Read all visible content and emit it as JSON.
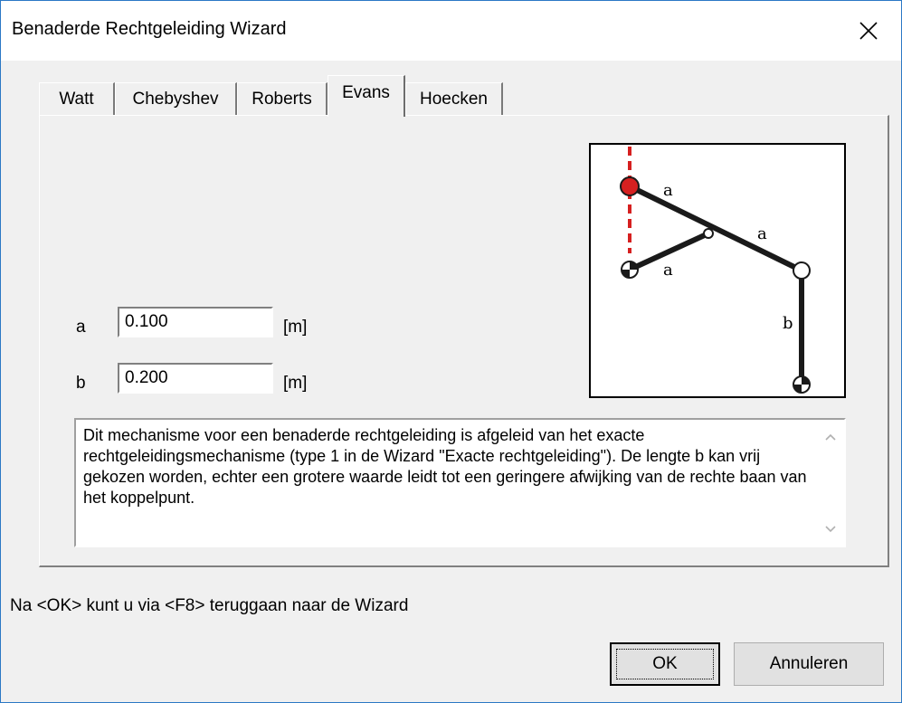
{
  "window": {
    "title": "Benaderde Rechtgeleiding Wizard"
  },
  "tabs": [
    {
      "label": "Watt",
      "active": false
    },
    {
      "label": "Chebyshev",
      "active": false
    },
    {
      "label": "Roberts",
      "active": false
    },
    {
      "label": "Evans",
      "active": true
    },
    {
      "label": "Hoecken",
      "active": false
    }
  ],
  "fields": {
    "a": {
      "label": "a",
      "value": "0.100",
      "unit": "[m]"
    },
    "b": {
      "label": "b",
      "value": "0.200",
      "unit": "[m]"
    }
  },
  "diagram": {
    "labels": {
      "a1": "a",
      "a2": "a",
      "a3": "a",
      "b": "b"
    },
    "colors": {
      "link": "#1a1a1a",
      "path": "#d62020",
      "coupler_point": "#d62020"
    }
  },
  "description": "Dit mechanisme voor een benaderde rechtgeleiding is afgeleid van het exacte rechtgeleidingsmechanisme (type 1 in de Wizard \"Exacte rechtgeleiding\"). De lengte b kan vrij gekozen worden, echter een grotere waarde leidt tot een geringere afwijking van de rechte baan van het koppelpunt.",
  "status": "Na <OK> kunt u via <F8> teruggaan naar de Wizard",
  "buttons": {
    "ok": "OK",
    "cancel": "Annuleren"
  },
  "icons": {
    "close": "close-icon",
    "scroll_up": "chevron-up-icon",
    "scroll_down": "chevron-down-icon"
  }
}
